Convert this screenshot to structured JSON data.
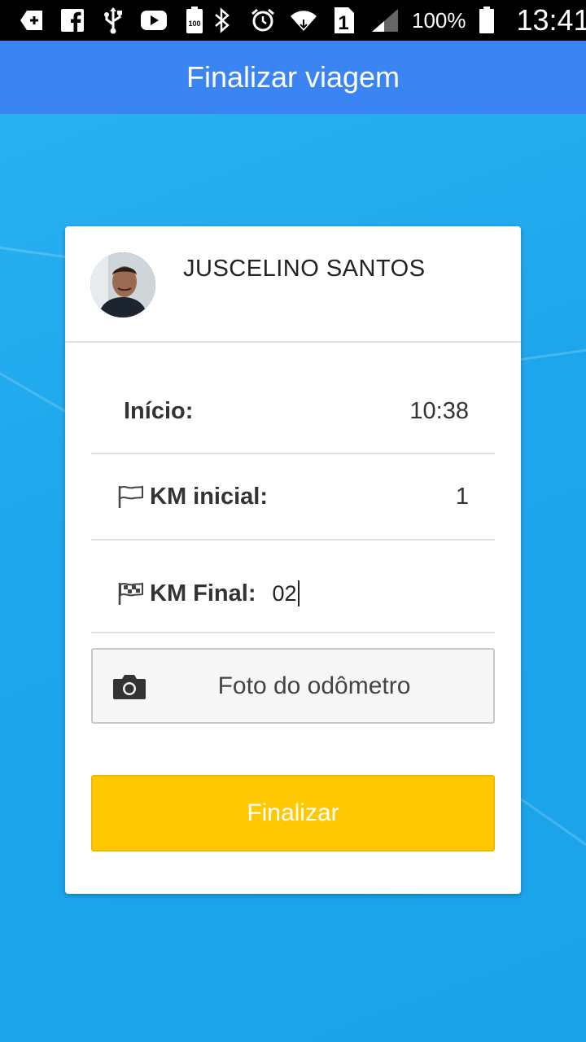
{
  "status_bar": {
    "left_icons": [
      "back-box-icon",
      "facebook-icon",
      "usb-icon",
      "youtube-icon",
      "battery-saver-icon"
    ],
    "battery_saver_text": "100",
    "right_icons": [
      "bluetooth-icon",
      "alarm-icon",
      "wifi-icon",
      "sim-1-icon",
      "signal-icon"
    ],
    "sim_label": "1",
    "battery_percent": "100%",
    "time": "13:41"
  },
  "app_bar": {
    "title": "Finalizar viagem"
  },
  "card": {
    "user_name": "JUSCELINO SANTOS",
    "start_label": "Início:",
    "start_value": "10:38",
    "km_start_label": "KM inicial:",
    "km_start_value": "1",
    "km_end_label": "KM Final:",
    "km_end_value": "02",
    "photo_button_label": "Foto do odômetro",
    "finish_button_label": "Finalizar"
  },
  "colors": {
    "app_bar": "#3b84f4",
    "background": "#22aaee",
    "finish_button": "#ffc800"
  }
}
